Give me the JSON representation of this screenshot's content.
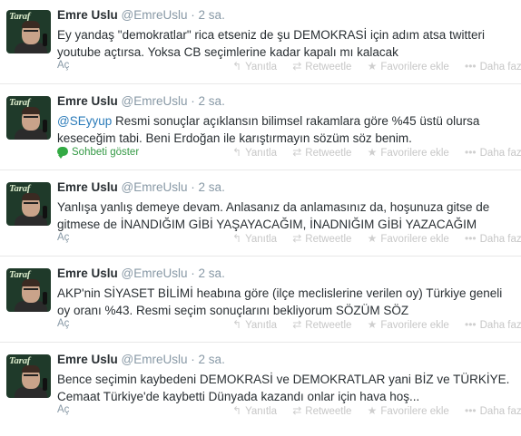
{
  "labels": {
    "reply": "Yanıtla",
    "retweet": "Retweetle",
    "favorite": "Favorilere ekle",
    "more": "Daha fazla",
    "expand": "Aç",
    "conversation": "Sohbeti göster"
  },
  "icons": {
    "reply": "↰",
    "retweet": "⇄",
    "favorite": "★",
    "more": "•••"
  },
  "avatar_logo": "Taraf",
  "tweets": [
    {
      "name": "Emre Uslu",
      "handle": "@EmreUslu",
      "sep": "·",
      "time": "2 sa.",
      "mention": "",
      "text": "Ey yandaş \"demokratlar\" rica etseniz de şu DEMOKRASİ için adım atsa twitteri youtube açtırsa. Yoksa CB seçimlerine kadar kapalı mı kalacak"
    },
    {
      "name": "Emre Uslu",
      "handle": "@EmreUslu",
      "sep": "·",
      "time": "2 sa.",
      "mention": "@SEyyup",
      "text": " Resmi sonuçlar açıklansın bilimsel rakamlara göre %45 üstü olursa keseceğim tabi. Beni Erdoğan ile karıştırmayın sözüm söz benim."
    },
    {
      "name": "Emre Uslu",
      "handle": "@EmreUslu",
      "sep": "·",
      "time": "2 sa.",
      "mention": "",
      "text": "Yanlışa yanlış demeye devam. Anlasanız da anlamasınız da, hoşunuza gitse de gitmese de İNANDIĞIM GİBİ YAŞAYACAĞIM, İNADNIĞIM GİBİ YAZACAĞIM"
    },
    {
      "name": "Emre Uslu",
      "handle": "@EmreUslu",
      "sep": "·",
      "time": "2 sa.",
      "mention": "",
      "text": "AKP'nin SİYASET BİLİMİ heabına göre (ilçe meclislerine verilen oy) Türkiye geneli oy oranı %43. Resmi seçim sonuçlarını bekliyorum SÖZÜM SÖZ"
    },
    {
      "name": "Emre Uslu",
      "handle": "@EmreUslu",
      "sep": "·",
      "time": "2 sa.",
      "mention": "",
      "text": "Bence seçimin kaybedeni DEMOKRASİ ve DEMOKRATLAR yani BİZ ve TÜRKİYE. Cemaat Türkiye'de kaybetti Dünyada kazandı onlar için  hava hoş..."
    }
  ]
}
